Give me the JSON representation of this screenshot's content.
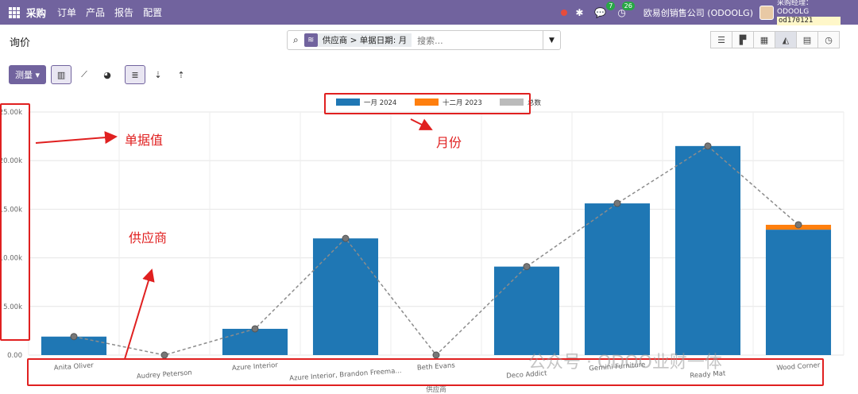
{
  "navbar": {
    "brand": "采购",
    "menu": [
      "订单",
      "产品",
      "报告",
      "配置"
    ],
    "icons": [
      "apps-grid-icon",
      "bug-icon",
      "chat-icon",
      "activity-icon"
    ],
    "messages_count": "7",
    "activities_count": "26",
    "company": "欧易创销售公司 (ODOOLG)",
    "user": "采购经理：ODOOLG",
    "database": "od170121"
  },
  "control_panel": {
    "title": "询价",
    "facet_label": "供应商 > 单据日期: 月",
    "search_placeholder": "搜索...",
    "view_switcher": [
      "list-view-icon",
      "kanban-view-icon",
      "pivot-view-icon",
      "graph-view-icon",
      "calendar-view-icon",
      "activity-view-icon"
    ],
    "active_view": "graph-view-icon",
    "measure_label": "测量"
  },
  "annotations": {
    "amount": "单据值",
    "month": "月份",
    "vendor": "供应商"
  },
  "watermark": "公众号 · ODOO业财一体",
  "colors": {
    "brand": "#71639e",
    "bar_jan": "#1f77b4",
    "bar_dec": "#ff7f0e",
    "annotation": "#e02020"
  },
  "chart_data": {
    "type": "bar",
    "stacked": true,
    "xlabel": "供应商",
    "ylabel": "",
    "ylim": [
      0,
      25000
    ],
    "yticks": [
      "0.00",
      "5.00k",
      "10.00k",
      "15.00k",
      "20.00k",
      "25.00k"
    ],
    "categories": [
      "Anita Oliver",
      "Audrey Peterson",
      "Azure Interior",
      "Azure Interior, Brandon Freema...",
      "Beth Evans",
      "Deco Addict",
      "Gemini Furniture",
      "Ready Mat",
      "Wood Corner"
    ],
    "series": [
      {
        "name": "一月 2024",
        "color": "#1f77b4",
        "values": [
          1900,
          0,
          2700,
          12000,
          0,
          9100,
          15600,
          21500,
          12900
        ]
      },
      {
        "name": "十二月 2023",
        "color": "#ff7f0e",
        "values": [
          0,
          0,
          0,
          0,
          0,
          0,
          0,
          0,
          500
        ]
      }
    ],
    "total_line": {
      "name": "总数",
      "values": [
        1900,
        0,
        2700,
        12000,
        0,
        9100,
        15600,
        21500,
        13400
      ]
    },
    "legend_position": "top",
    "grid": true
  }
}
